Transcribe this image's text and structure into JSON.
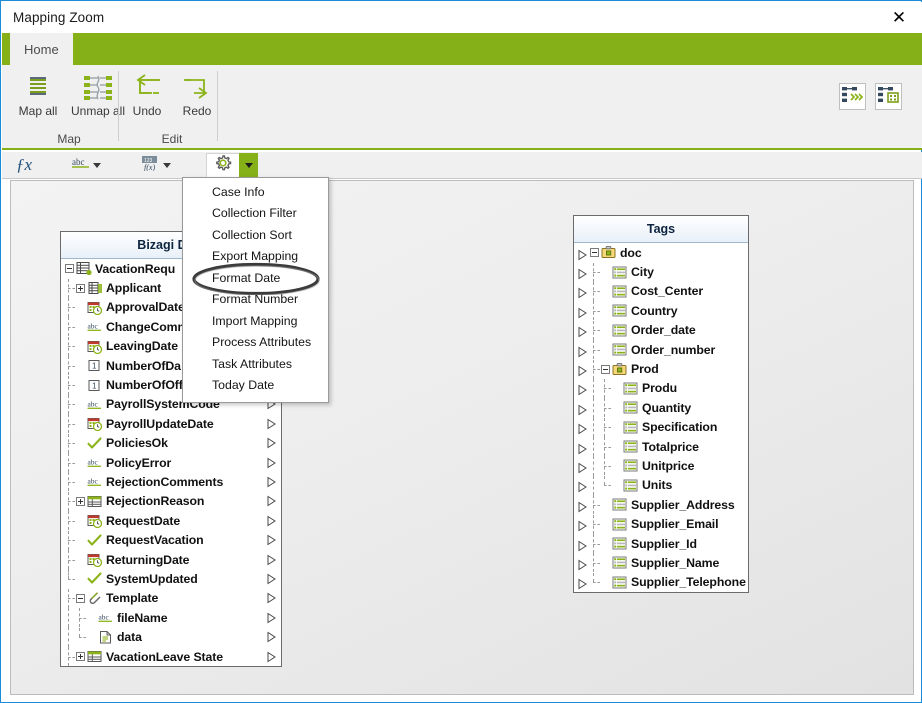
{
  "window": {
    "title": "Mapping Zoom",
    "close_label": "✕",
    "close_icon": "close-icon"
  },
  "ribbon": {
    "tabs": [
      {
        "label": "Home",
        "active": true
      }
    ],
    "groups": [
      {
        "title": "Map",
        "buttons": [
          {
            "label": "Map all",
            "icon": "map-all-icon"
          },
          {
            "label": "Unmap all",
            "icon": "unmap-all-icon"
          }
        ]
      },
      {
        "title": "Edit",
        "buttons": [
          {
            "label": "Undo",
            "icon": "undo-arrow-icon"
          },
          {
            "label": "Redo",
            "icon": "redo-arrow-icon"
          }
        ]
      }
    ],
    "corner_buttons": [
      {
        "icon": "auto-map-icon",
        "name": "auto-map-button"
      },
      {
        "icon": "map-grid-icon",
        "name": "map-grid-button"
      }
    ]
  },
  "formula_bar": {
    "fx_label": "ƒx",
    "items": [
      {
        "icon": "fx-icon",
        "name": "fx-button"
      },
      {
        "icon": "abc-text-icon",
        "name": "text-function-dropdown"
      },
      {
        "icon": "number-format-icon",
        "name": "number-function-dropdown"
      },
      {
        "icon": "gear-icon",
        "name": "advanced-functions-button"
      }
    ]
  },
  "menu": {
    "name": "advanced-functions-menu",
    "items": [
      "Case Info",
      "Collection Filter",
      "Collection Sort",
      "Export Mapping",
      "Format Date",
      "Format Number",
      "Import Mapping",
      "Process Attributes",
      "Task Attributes",
      "Today Date"
    ],
    "highlighted": "Format Date"
  },
  "panels": {
    "left": {
      "title": "Bizagi Data",
      "nodes": [
        {
          "label": "VacationRequ",
          "icon": "entity-icon",
          "depth": 0,
          "expander": "minus",
          "truncated": true
        },
        {
          "label": "Applicant",
          "icon": "entity-related-icon",
          "depth": 1,
          "expander": "plus"
        },
        {
          "label": "ApprovalDate",
          "icon": "datetime-icon",
          "depth": 1,
          "truncated": true
        },
        {
          "label": "ChangeComm",
          "icon": "abc-icon",
          "depth": 1,
          "truncated": true
        },
        {
          "label": "LeavingDate",
          "icon": "datetime-icon",
          "depth": 1
        },
        {
          "label": "NumberOfDa",
          "icon": "number-icon",
          "depth": 1,
          "truncated": true
        },
        {
          "label": "NumberOfOff",
          "icon": "number-icon",
          "depth": 1,
          "truncated": true
        },
        {
          "label": "PayrollSystemCode",
          "icon": "abc-icon",
          "depth": 1
        },
        {
          "label": "PayrollUpdateDate",
          "icon": "datetime-icon",
          "depth": 1
        },
        {
          "label": "PoliciesOk",
          "icon": "boolean-check-icon",
          "depth": 1
        },
        {
          "label": "PolicyError",
          "icon": "abc-icon",
          "depth": 1
        },
        {
          "label": "RejectionComments",
          "icon": "abc-icon",
          "depth": 1
        },
        {
          "label": "RejectionReason",
          "icon": "table-icon",
          "depth": 1,
          "expander": "plus"
        },
        {
          "label": "RequestDate",
          "icon": "datetime-icon",
          "depth": 1
        },
        {
          "label": "RequestVacation",
          "icon": "boolean-check-icon",
          "depth": 1
        },
        {
          "label": "ReturningDate",
          "icon": "datetime-icon",
          "depth": 1
        },
        {
          "label": "SystemUpdated",
          "icon": "boolean-check-icon",
          "depth": 1,
          "last": true
        },
        {
          "label": "Template",
          "icon": "attachment-icon",
          "depth": 1,
          "expander": "minus"
        },
        {
          "label": "fileName",
          "icon": "abc-icon",
          "depth": 2
        },
        {
          "label": "data",
          "icon": "file-icon",
          "depth": 2,
          "last": true
        },
        {
          "label": "VacationLeave State",
          "icon": "table-icon",
          "depth": 1,
          "expander": "plus"
        }
      ]
    },
    "right": {
      "title": "Tags",
      "nodes": [
        {
          "label": "doc",
          "icon": "folder-tag-icon",
          "depth": 0,
          "expander": "minus"
        },
        {
          "label": "City",
          "icon": "tag-icon",
          "depth": 1
        },
        {
          "label": "Cost_Center",
          "icon": "tag-icon",
          "depth": 1
        },
        {
          "label": "Country",
          "icon": "tag-icon",
          "depth": 1
        },
        {
          "label": "Order_date",
          "icon": "tag-icon",
          "depth": 1
        },
        {
          "label": "Order_number",
          "icon": "tag-icon",
          "depth": 1
        },
        {
          "label": "Prod",
          "icon": "folder-tag-icon",
          "depth": 1,
          "expander": "minus"
        },
        {
          "label": "Produ",
          "icon": "tag-icon",
          "depth": 2
        },
        {
          "label": "Quantity",
          "icon": "tag-icon",
          "depth": 2
        },
        {
          "label": "Specification",
          "icon": "tag-icon",
          "depth": 2
        },
        {
          "label": "Totalprice",
          "icon": "tag-icon",
          "depth": 2
        },
        {
          "label": "Unitprice",
          "icon": "tag-icon",
          "depth": 2
        },
        {
          "label": "Units",
          "icon": "tag-icon",
          "depth": 2,
          "last": true
        },
        {
          "label": "Supplier_Address",
          "icon": "tag-icon",
          "depth": 1
        },
        {
          "label": "Supplier_Email",
          "icon": "tag-icon",
          "depth": 1
        },
        {
          "label": "Supplier_Id",
          "icon": "tag-icon",
          "depth": 1
        },
        {
          "label": "Supplier_Name",
          "icon": "tag-icon",
          "depth": 1
        },
        {
          "label": "Supplier_Telephone",
          "icon": "tag-icon",
          "depth": 1,
          "last": true
        }
      ]
    }
  },
  "colors": {
    "accent_green": "#86b017",
    "ribbon_bg": "#f0f0f0",
    "window_border": "#1a8cd8",
    "panel_header": "#e8f0f8",
    "icon_dark": "#34495e",
    "icon_green": "#86b017"
  }
}
